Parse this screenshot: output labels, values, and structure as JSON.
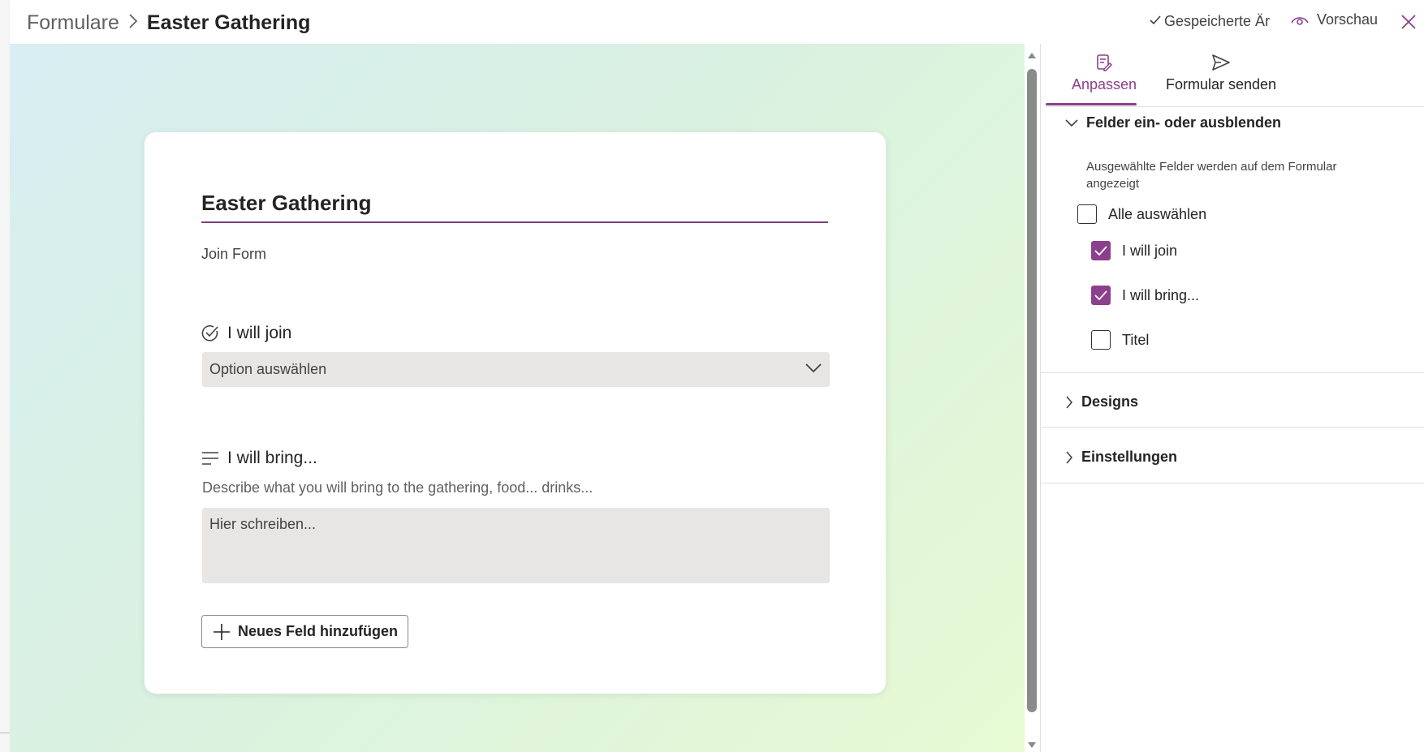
{
  "breadcrumb": {
    "root": "Formulare",
    "separator": ">",
    "current": "Easter Gathering"
  },
  "topbar": {
    "saved_status": "Gespeicherte Är",
    "saved_icon": "checkmark-icon",
    "preview_label": "Vorschau",
    "preview_icon": "eye-icon",
    "close_icon": "close-icon"
  },
  "form": {
    "title": "Easter Gathering",
    "subtitle": "Join Form",
    "fields": [
      {
        "label": "I will join",
        "icon": "choice-check-icon",
        "placeholder": "Option auswählen"
      },
      {
        "label": "I will bring...",
        "icon": "text-lines-icon",
        "description": "Describe what you will bring to the gathering, food... drinks...",
        "placeholder": "Hier schreiben..."
      }
    ],
    "add_field_label": "Neues Feld hinzufügen"
  },
  "panel": {
    "tabs": [
      {
        "label": "Anpassen",
        "icon": "form-edit-icon",
        "active": true
      },
      {
        "label": "Formular senden",
        "icon": "send-icon",
        "active": false
      }
    ],
    "sections": {
      "fields": {
        "title": "Felder ein- oder ausblenden",
        "expanded": true,
        "description": "Ausgewählte Felder werden auf dem Formular angezeigt",
        "select_all": {
          "label": "Alle auswählen",
          "checked": false
        },
        "items": [
          {
            "label": "I will join",
            "checked": true
          },
          {
            "label": "I will bring...",
            "checked": true
          },
          {
            "label": "Titel",
            "checked": false
          }
        ]
      },
      "designs": {
        "title": "Designs",
        "expanded": false
      },
      "settings": {
        "title": "Einstellungen",
        "expanded": false
      }
    }
  },
  "colors": {
    "accent": "#8c3f8c",
    "field_background": "#e8e6e4",
    "canvas_gradient_start": "#d8eef3",
    "canvas_gradient_end": "#e7fad4"
  }
}
